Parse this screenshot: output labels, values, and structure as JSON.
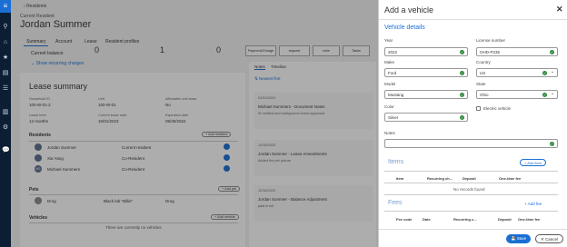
{
  "breadcrumb": {
    "back_label": "Residents"
  },
  "header": {
    "subtitle": "Current Resident",
    "title": "Jordan Summer"
  },
  "tabs": [
    {
      "label": "Summary"
    },
    {
      "label": "Account"
    },
    {
      "label": "Lease"
    },
    {
      "label": "Resident profiles"
    }
  ],
  "balance": {
    "label": "Current balance",
    "toggle": "Show recurring charges",
    "stats": [
      "0",
      "1",
      "0"
    ]
  },
  "actions": [
    {
      "label": "Payment/Charge"
    },
    {
      "label": "request"
    },
    {
      "label": "note"
    },
    {
      "label": "Tasks"
    }
  ],
  "lease": {
    "heading": "Lease summary",
    "fields": [
      {
        "label": "Household ID",
        "value": "100-W-01-2"
      },
      {
        "label": "Unit",
        "value": "100-W-01"
      },
      {
        "label": "Affordable unit lease",
        "value": "No"
      },
      {
        "label": "Lease term",
        "value": "12 months"
      },
      {
        "label": "Current lease start",
        "value": "10/01/2023"
      },
      {
        "label": "Expiration date",
        "value": "09/30/2024"
      }
    ]
  },
  "residents": {
    "heading": "Residents",
    "add_label": "Add resident",
    "rows": [
      {
        "initials": "",
        "name": "Jordan Summer",
        "role": "Current resident"
      },
      {
        "initials": "",
        "name": "Xia Yang",
        "role": "Co-Resident"
      },
      {
        "initials": "MS",
        "name": "Michael Summers",
        "role": "Co-Resident"
      }
    ]
  },
  "pets": {
    "heading": "Pets",
    "add_label": "Add pet",
    "rows": [
      {
        "name": "Drog",
        "desc": "Black lab \"Billie\"",
        "type": "Drog"
      }
    ]
  },
  "vehicles": {
    "heading": "Vehicles",
    "add_label": "Add vehicle",
    "empty": "There are currently no vehicles"
  },
  "notes": {
    "tabs": [
      "Notes",
      "Timeline"
    ],
    "filter": "Newest first",
    "items": [
      {
        "date": "01/01/2024",
        "title": "Michael Summers - Document Notes",
        "body": "ID verified and background check approved"
      },
      {
        "date": "12/16/2023",
        "title": "Jordan Summer - Lease Amendments",
        "body": "Added the pet picture"
      },
      {
        "date": "12/16/2023",
        "title": "Jordan Summer - Balance Adjustment",
        "body": "paid in full"
      }
    ]
  },
  "panel": {
    "title": "Add a vehicle",
    "details_heading": "Vehicle details",
    "year": {
      "label": "Year",
      "value": "2022"
    },
    "license": {
      "label": "License number",
      "value": "OHD-P235"
    },
    "make": {
      "label": "Make",
      "value": "Ford"
    },
    "country": {
      "label": "Country",
      "value": "US"
    },
    "model": {
      "label": "Model",
      "value": "Mustang"
    },
    "state": {
      "label": "State",
      "value": "Ohio"
    },
    "color": {
      "label": "Color",
      "value": "Silver"
    },
    "electric": {
      "label": "Electric vehicle"
    },
    "notes": {
      "label": "Notes",
      "value": ""
    },
    "items": {
      "heading": "Items",
      "add_label": "Add item",
      "cols": [
        "Item",
        "Recurring ch...",
        "Deposit",
        "One-time fee"
      ],
      "empty": "No records found"
    },
    "fees": {
      "heading": "Fees",
      "add_label": "Add fee",
      "cols": [
        "Fee code",
        "Date",
        "Recurring c...",
        "Deposit",
        "One-time fee"
      ]
    },
    "save_label": "Save",
    "cancel_label": "Cancel"
  },
  "colors": {
    "accent": "#1a6fd4",
    "rail": "#0b1e33",
    "success": "#2e8b3e"
  }
}
